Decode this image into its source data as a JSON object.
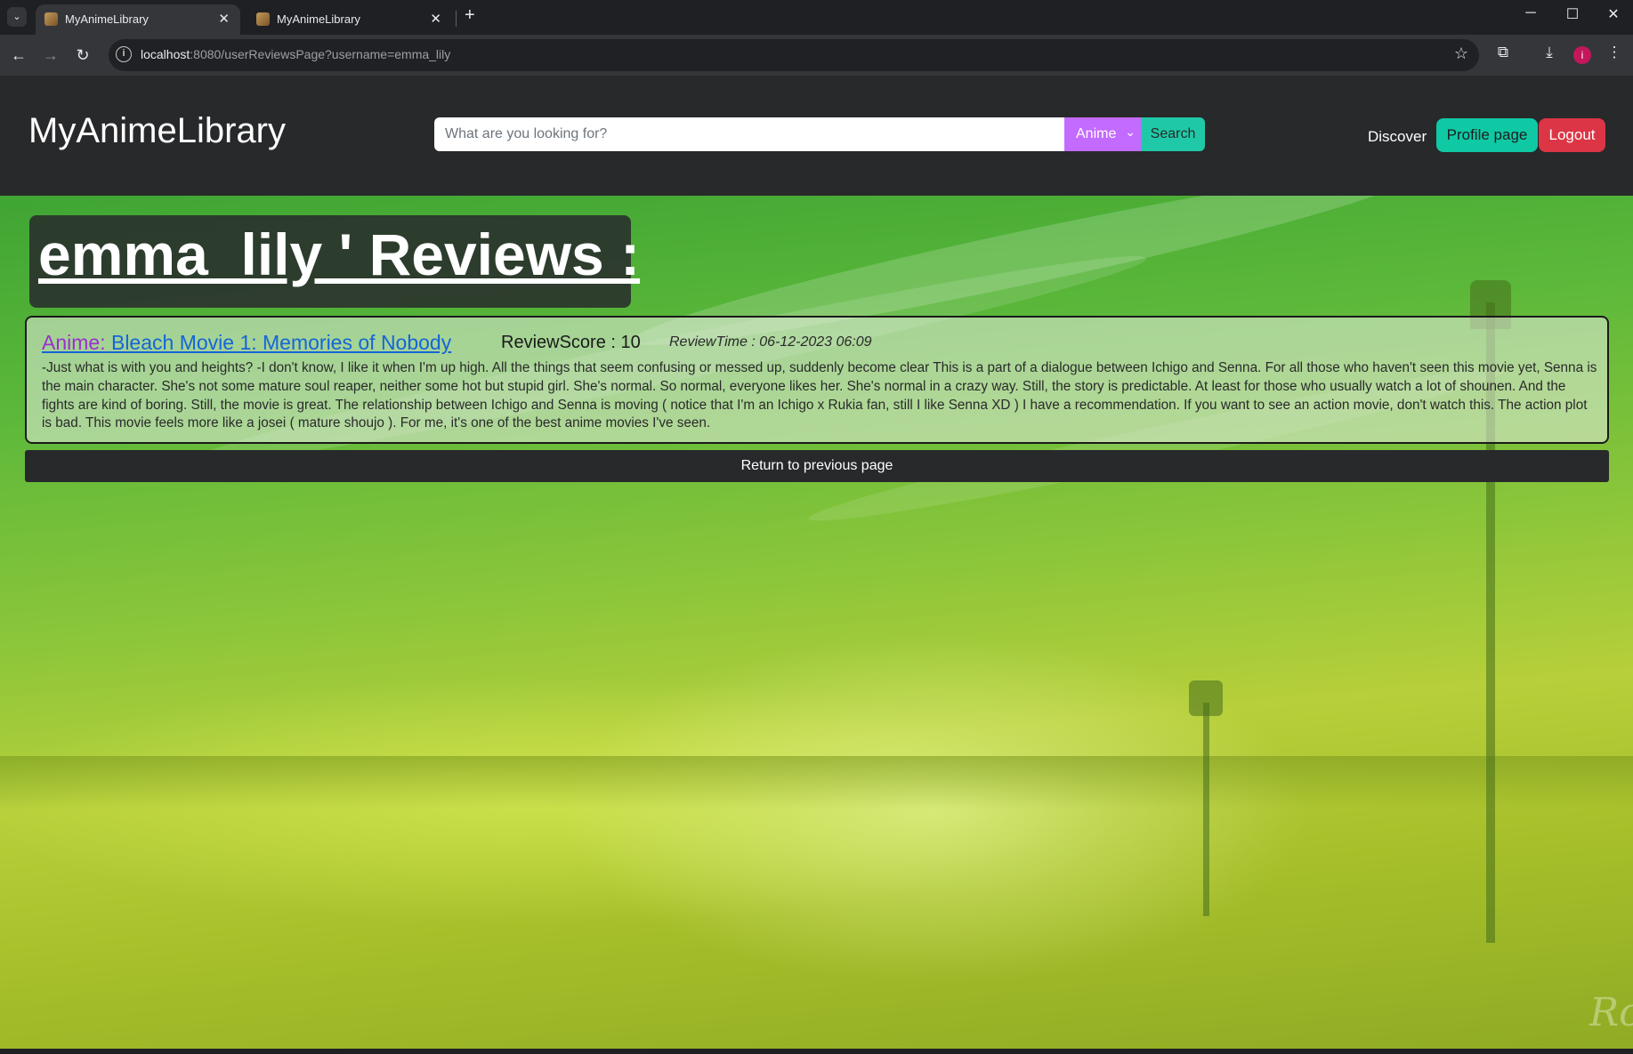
{
  "browser": {
    "tabs": [
      {
        "title": "MyAnimeLibrary",
        "active": true
      },
      {
        "title": "MyAnimeLibrary",
        "active": false
      }
    ],
    "url_host": "localhost",
    "url_rest": ":8080/userReviewsPage?username=emma_lily",
    "profile_initial": "i"
  },
  "header": {
    "brand": "MyAnimeLibrary",
    "search_placeholder": "What are you looking for?",
    "search_type": "Anime",
    "search_button": "Search",
    "discover": "Discover",
    "profile_button": "Profile page",
    "logout_button": "Logout"
  },
  "page": {
    "title": "emma_lily ' Reviews :",
    "reviews": [
      {
        "type_prefix": "Anime:",
        "anime_title": "Bleach Movie 1: Memories of Nobody",
        "score": "ReviewScore : 10",
        "time": "ReviewTime : 06-12-2023 06:09",
        "text": "-Just what is with you and heights? -I don't know, I like it when I'm up high. All the things that seem confusing or messed up, suddenly become clear This is a part of a dialogue between Ichigo and Senna. For all those who haven't seen this movie yet, Senna is the main character. She's not some mature soul reaper, neither some hot but stupid girl. She's normal. So normal, everyone likes her. She's normal in a crazy way. Still, the story is predictable. At least for those who usually watch a lot of shounen. And the fights are kind of boring. Still, the movie is great. The relationship between Ichigo and Senna is moving ( notice that I'm an Ichigo x Rukia fan, still I like Senna XD ) I have a recommendation. If you want to see an action movie, don't watch this. The action plot is bad. This movie feels more like a josei ( mature shoujo ). For me, it's one of the best anime movies I've seen."
      }
    ],
    "return_button": "Return to previous page"
  }
}
